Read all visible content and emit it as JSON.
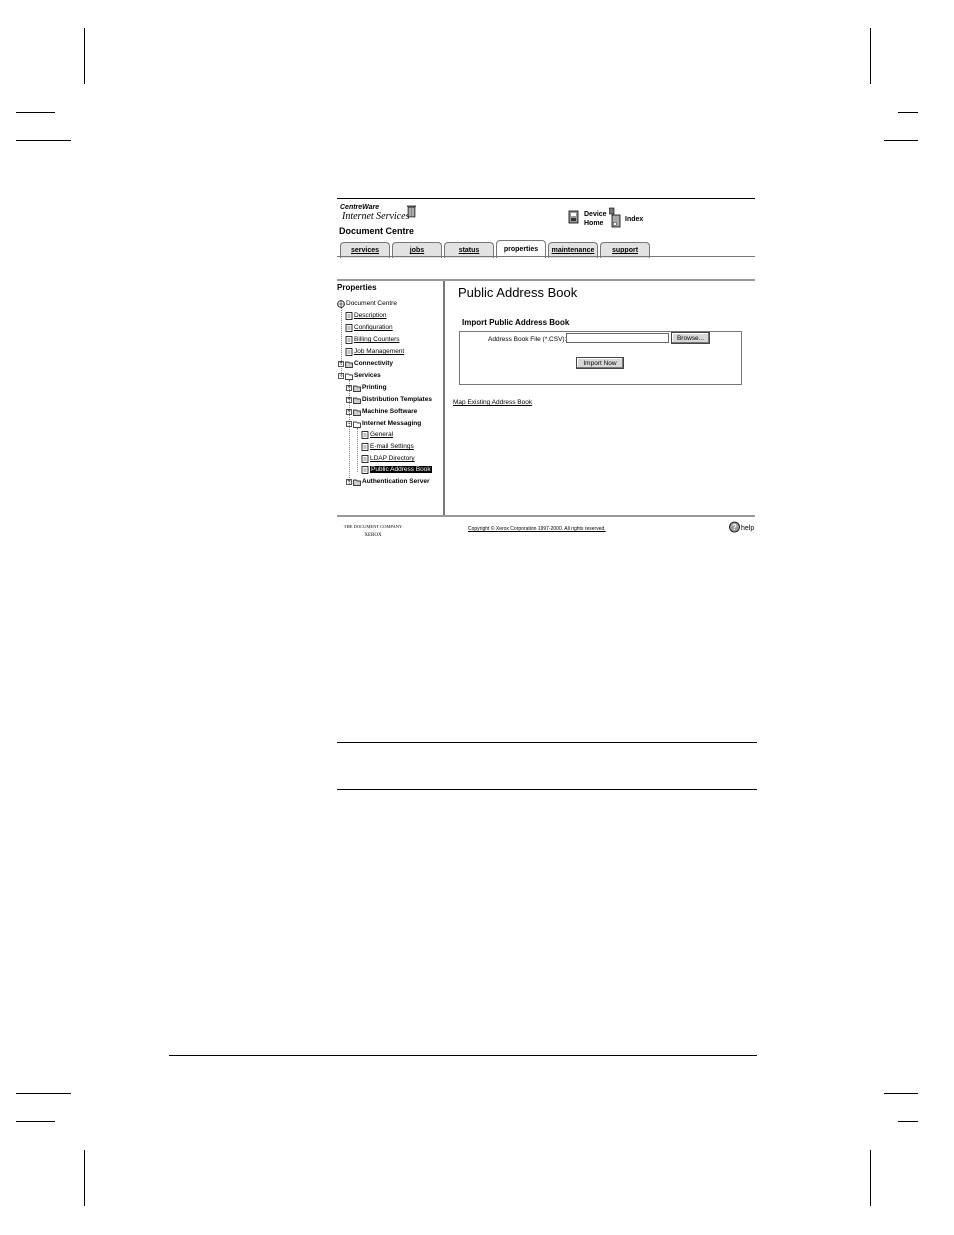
{
  "header": {
    "brand_top": "CentreWare",
    "brand_bottom": "Internet Services",
    "device_title": "Document Centre",
    "nav_device_home": "Device\nHome",
    "nav_index": "Index"
  },
  "tabs": [
    "services",
    "jobs",
    "status",
    "properties",
    "maintenance",
    "support"
  ],
  "active_tab": "properties",
  "sidebar": {
    "title": "Properties",
    "root": "Document Centre",
    "items": [
      {
        "label": "Description",
        "type": "page"
      },
      {
        "label": "Configuration",
        "type": "page"
      },
      {
        "label": "Billing Counters",
        "type": "page"
      },
      {
        "label": "Job Management",
        "type": "page"
      },
      {
        "label": "Connectivity",
        "type": "folder"
      },
      {
        "label": "Services",
        "type": "folder"
      },
      {
        "label": "Printing",
        "type": "folder"
      },
      {
        "label": "Distribution Templates",
        "type": "folder"
      },
      {
        "label": "Machine Software",
        "type": "folder"
      },
      {
        "label": "Internet Messaging",
        "type": "folder"
      },
      {
        "label": "General",
        "type": "page"
      },
      {
        "label": "E-mail Settings",
        "type": "page"
      },
      {
        "label": "LDAP Directory",
        "type": "page"
      },
      {
        "label": "Public Address Book",
        "type": "page"
      },
      {
        "label": "Authentication Server",
        "type": "folder"
      }
    ]
  },
  "main": {
    "title": "Public Address Book",
    "section_title": "Import Public Address Book",
    "file_label": "Address Book File (*.CSV):",
    "file_value": "",
    "browse_label": "Browse...",
    "import_label": "Import Now",
    "map_link": "Map Existing Address Book"
  },
  "footer": {
    "company_line1": "THE DOCUMENT COMPANY",
    "company_line2": "XEROX",
    "copyright": "Copyright © Xerox Corporation 1997-2000. All rights reserved.",
    "help": "help"
  }
}
